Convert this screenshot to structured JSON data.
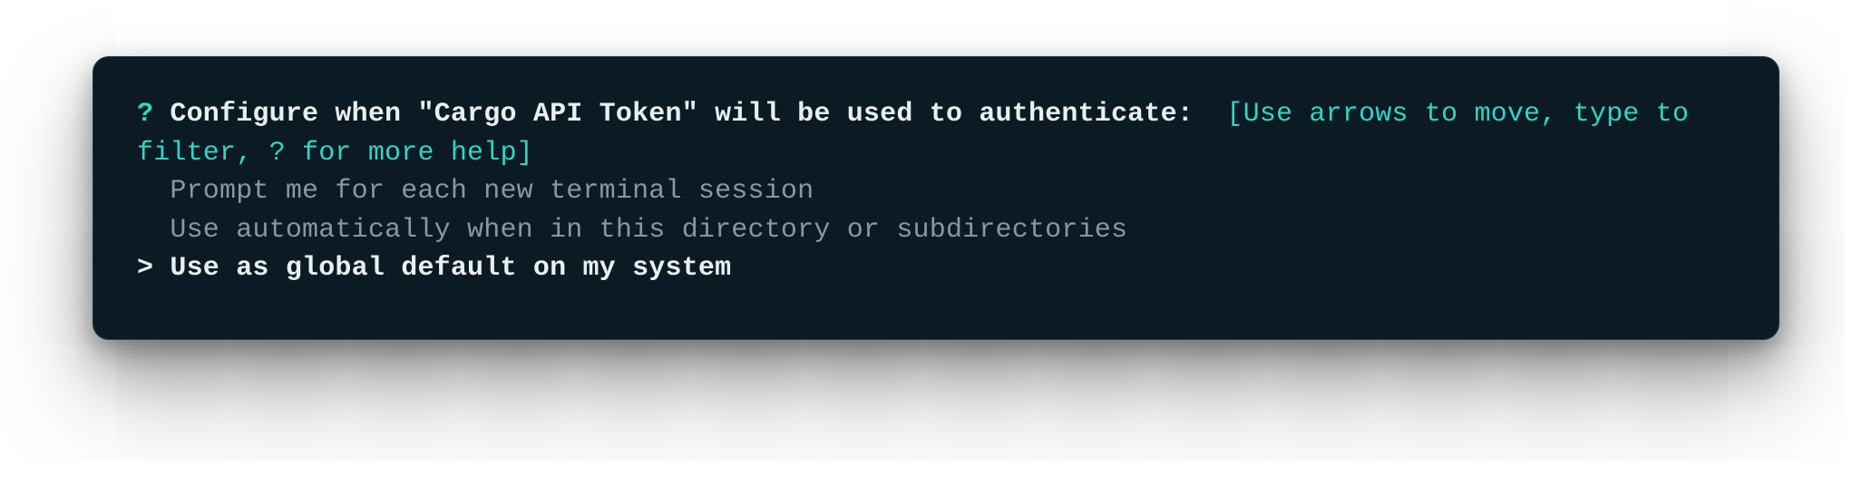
{
  "prompt": {
    "marker": "?",
    "question": "Configure when \"Cargo API Token\" will be used to authenticate:",
    "hint": "[Use arrows to move, type to filter, ? for more help]"
  },
  "options": [
    {
      "label": "Prompt me for each new terminal session",
      "selected": false
    },
    {
      "label": "Use automatically when in this directory or subdirectories",
      "selected": false
    },
    {
      "label": "Use as global default on my system",
      "selected": true
    }
  ],
  "selected_marker": ">"
}
